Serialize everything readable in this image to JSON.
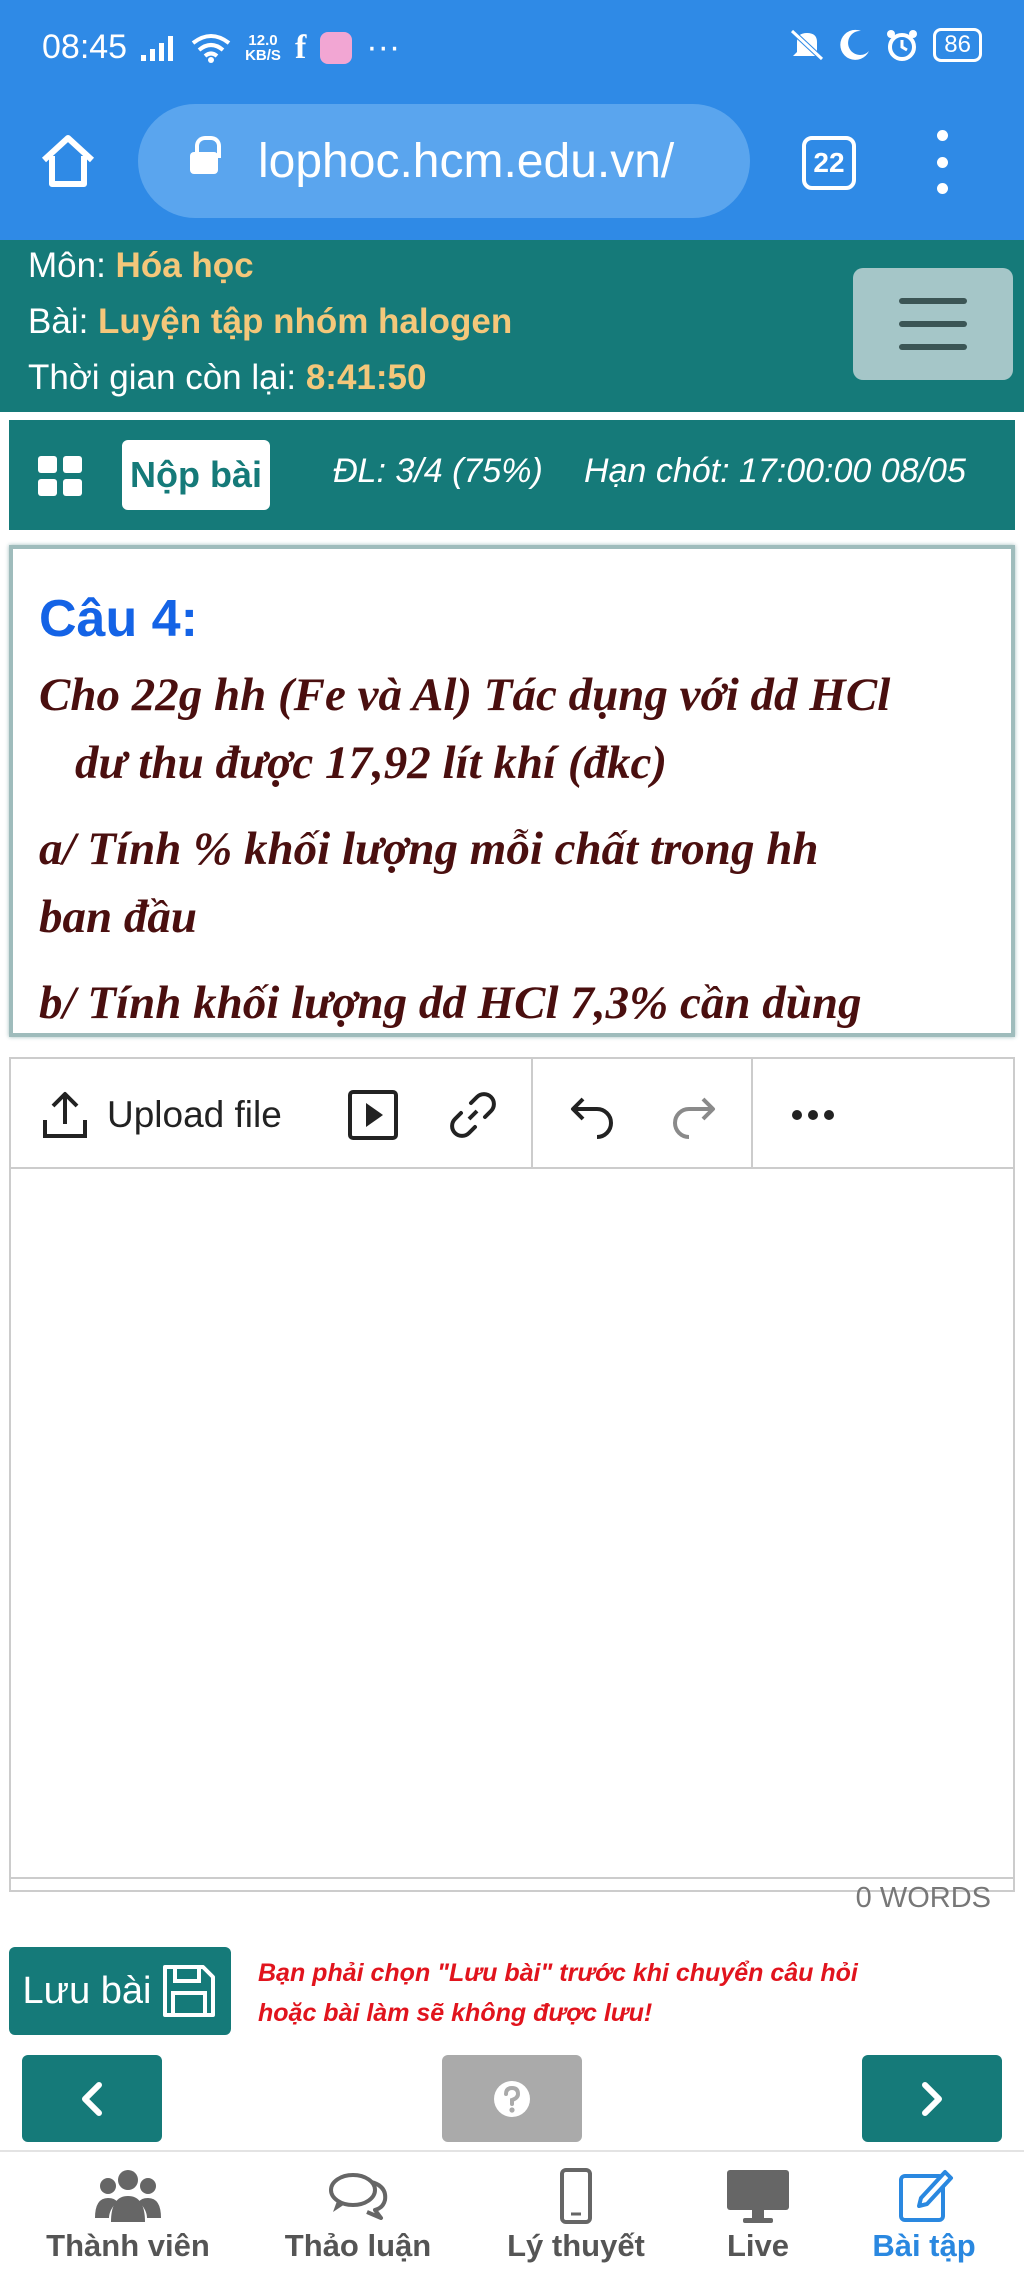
{
  "status_bar": {
    "time": "08:45",
    "net_speed_value": "12.0",
    "net_speed_unit": "KB/S",
    "more": "···",
    "battery": "86"
  },
  "browser": {
    "url": "lophoc.hcm.edu.vn/",
    "tab_count": "22"
  },
  "info": {
    "subject_label": "Môn:",
    "subject_value": "Hóa học",
    "lesson_label": "Bài:",
    "lesson_value": "Luyện tập nhóm halogen",
    "time_left_label": "Thời gian còn lại:",
    "time_left_value": "8:41:50"
  },
  "submit_bar": {
    "submit_label": "Nộp bài",
    "progress": "ĐL: 3/4 (75%)",
    "deadline": "Hạn chót: 17:00:00 08/05"
  },
  "question": {
    "title": "Câu 4:",
    "line1": "Cho 22g hh (Fe và Al) Tác dụng với dd HCl",
    "line2": "dư thu được 17,92 lít khí (đkc)",
    "line3": "a/ Tính % khối lượng mỗi chất trong hh",
    "line4": "ban đầu",
    "line5": "b/ Tính khối lượng dd HCl 7,3% cần dùng"
  },
  "editor": {
    "upload_label": "Upload file",
    "word_count": "0 WORDS"
  },
  "save": {
    "label": "Lưu bài",
    "warning_line1": "Bạn phải chọn \"Lưu bài\" trước khi chuyển câu hỏi",
    "warning_line2": "hoặc bài làm sẽ không được lưu!"
  },
  "bottom_nav": {
    "members": "Thành viên",
    "discussion": "Thảo luận",
    "theory": "Lý thuyết",
    "live": "Live",
    "exercises": "Bài tập"
  },
  "colors": {
    "browser_blue": "#2f8ae6",
    "teal": "#157a79",
    "accent_orange": "#f4c77a",
    "question_title_blue": "#1463e6",
    "question_text": "#4a0f0f",
    "warning_red": "#e1141d",
    "active_tab_blue": "#2a88e0"
  }
}
